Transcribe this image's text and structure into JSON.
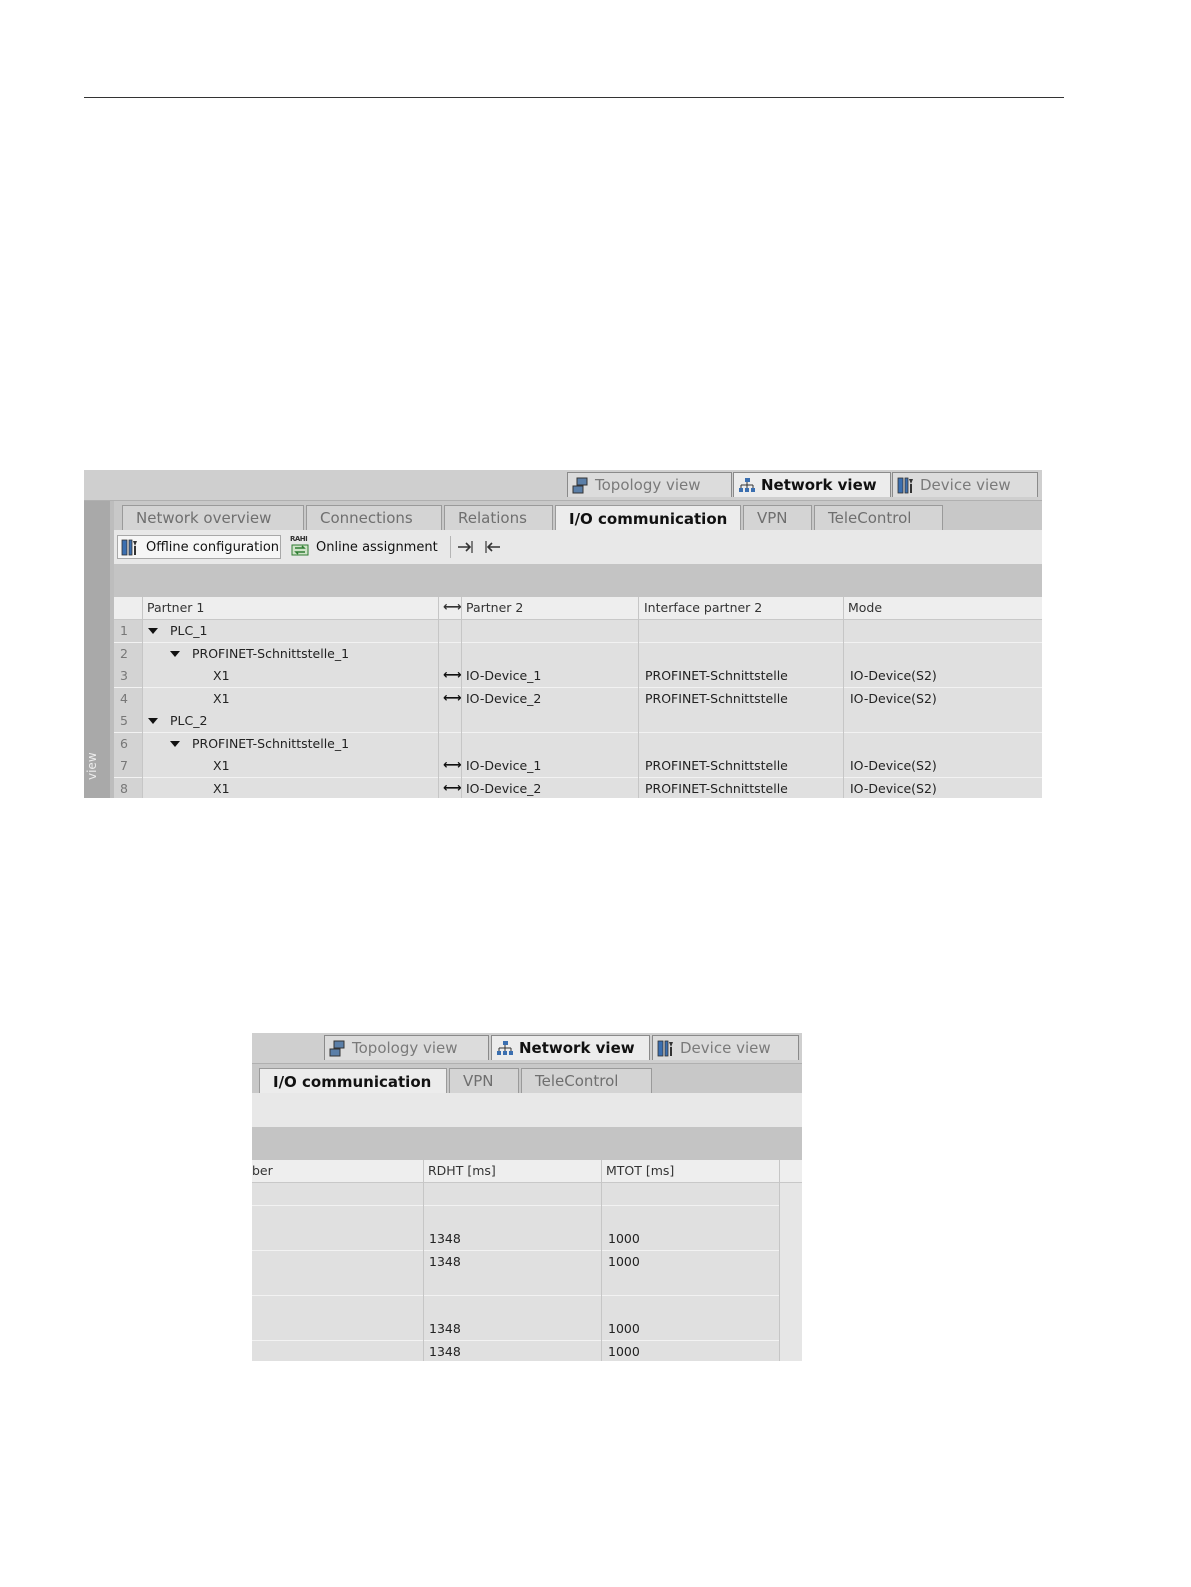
{
  "views": {
    "topology": "Topology view",
    "network": "Network view",
    "device": "Device view"
  },
  "tabs": {
    "network_overview": "Network overview",
    "connections": "Connections",
    "relations": "Relations",
    "io_communication": "I/O communication",
    "vpn": "VPN",
    "telecontrol": "TeleControl"
  },
  "toolbar": {
    "offline": "Offline configuration",
    "online": "Online assignment",
    "online_icon_text": "RAHI"
  },
  "side_label": "view",
  "columns": {
    "partner1": "Partner 1",
    "partner2": "Partner 2",
    "interface2": "Interface partner 2",
    "mode": "Mode",
    "number_partial": "ber",
    "rdht": "RDHT [ms]",
    "mtot": "MTOT [ms]"
  },
  "rows": [
    {
      "n": "1",
      "p1": "PLC_1",
      "p2": "",
      "if2": "",
      "mode": "",
      "rdht": "",
      "mtot": ""
    },
    {
      "n": "2",
      "p1": "PROFINET-Schnittstelle_1",
      "p2": "",
      "if2": "",
      "mode": "",
      "rdht": "",
      "mtot": ""
    },
    {
      "n": "3",
      "p1": "X1",
      "p2": "IO-Device_1",
      "if2": "PROFINET-Schnittstelle",
      "mode": "IO-Device(S2)",
      "rdht": "1348",
      "mtot": "1000"
    },
    {
      "n": "4",
      "p1": "X1",
      "p2": "IO-Device_2",
      "if2": "PROFINET-Schnittstelle",
      "mode": "IO-Device(S2)",
      "rdht": "1348",
      "mtot": "1000"
    },
    {
      "n": "5",
      "p1": "PLC_2",
      "p2": "",
      "if2": "",
      "mode": "",
      "rdht": "",
      "mtot": ""
    },
    {
      "n": "6",
      "p1": "PROFINET-Schnittstelle_1",
      "p2": "",
      "if2": "",
      "mode": "",
      "rdht": "",
      "mtot": ""
    },
    {
      "n": "7",
      "p1": "X1",
      "p2": "IO-Device_1",
      "if2": "PROFINET-Schnittstelle",
      "mode": "IO-Device(S2)",
      "rdht": "1348",
      "mtot": "1000"
    },
    {
      "n": "8",
      "p1": "X1",
      "p2": "IO-Device_2",
      "if2": "PROFINET-Schnittstelle",
      "mode": "IO-Device(S2)",
      "rdht": "1348",
      "mtot": "1000"
    }
  ]
}
